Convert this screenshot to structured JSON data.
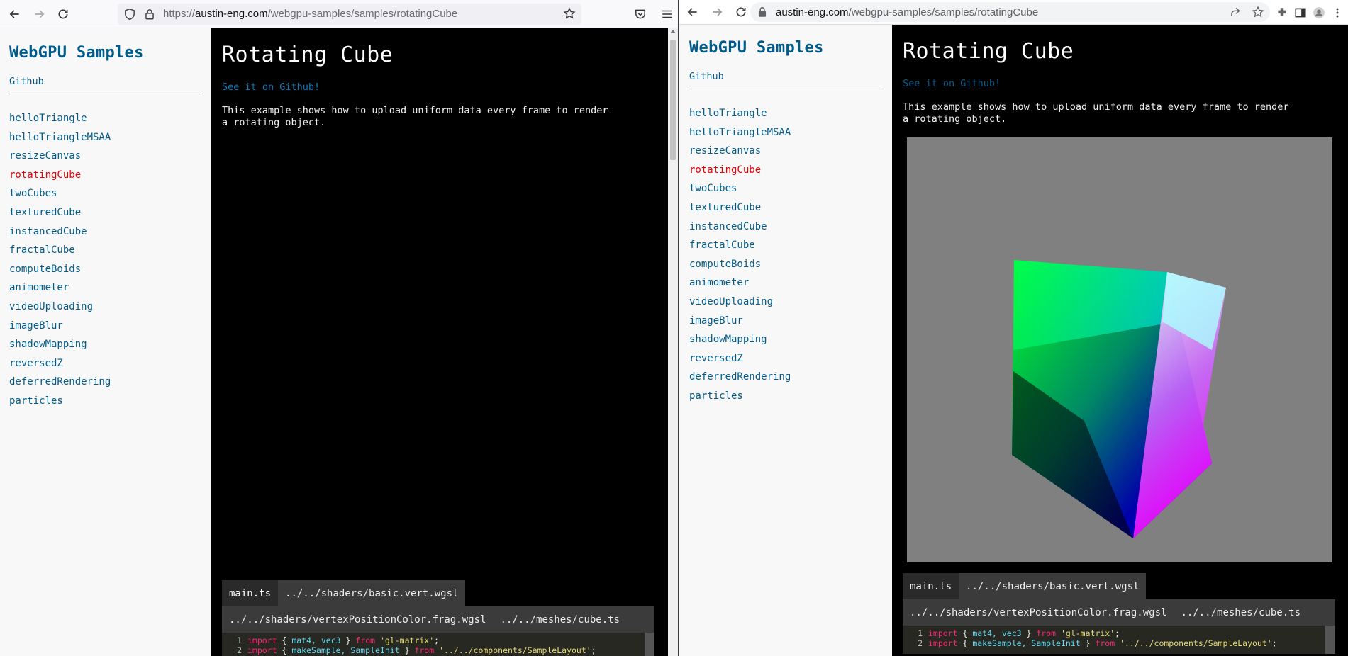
{
  "left_window": {
    "url_scheme": "https://",
    "url_host": "austin-eng.com",
    "url_path": "/webgpu-samples/samples/rotatingCube"
  },
  "right_window": {
    "url_host": "austin-eng.com",
    "url_path": "/webgpu-samples/samples/rotatingCube"
  },
  "sidebar": {
    "title": "WebGPU Samples",
    "github": "Github",
    "items": [
      "helloTriangle",
      "helloTriangleMSAA",
      "resizeCanvas",
      "rotatingCube",
      "twoCubes",
      "texturedCube",
      "instancedCube",
      "fractalCube",
      "computeBoids",
      "animometer",
      "videoUploading",
      "imageBlur",
      "shadowMapping",
      "reversedZ",
      "deferredRendering",
      "particles"
    ],
    "active_item": "rotatingCube"
  },
  "main": {
    "title": "Rotating Cube",
    "github_link": "See it on Github!",
    "description": "This example shows how to upload uniform data every frame to render a rotating object."
  },
  "tabs": {
    "main_ts": "main.ts",
    "vert": "../../shaders/basic.vert.wgsl",
    "frag": "../../shaders/vertexPositionColor.frag.wgsl",
    "cube": "../../meshes/cube.ts"
  },
  "code": {
    "line1_num": "1",
    "line1_kw1": "import",
    "line1_brace_open": " { ",
    "line1_ids": "mat4, vec3",
    "line1_brace_close": " } ",
    "line1_kw2": "from",
    "line1_str": " 'gl-matrix'",
    "line1_end": ";",
    "line2_num": "2",
    "line2_kw1": "import",
    "line2_brace_open": " { ",
    "line2_ids": "makeSample, SampleInit",
    "line2_brace_close": " } ",
    "line2_kw2": "from",
    "line2_str": " '../../components/SampleLayout'",
    "line2_end": ";"
  },
  "colors": {
    "link": "#015b8a",
    "active": "#ee0000",
    "canvas_bg": "#808080",
    "main_bg": "#000000"
  },
  "icons": {
    "left_toolbar": [
      "back-arrow-icon",
      "forward-arrow-icon",
      "reload-icon",
      "shield-icon",
      "lock-icon",
      "star-icon",
      "pocket-icon",
      "menu-icon"
    ],
    "right_toolbar": [
      "back-arrow-icon",
      "forward-arrow-icon",
      "reload-icon",
      "lock-icon",
      "share-icon",
      "star-icon",
      "extensions-icon",
      "sidepanel-icon",
      "profile-icon"
    ]
  }
}
